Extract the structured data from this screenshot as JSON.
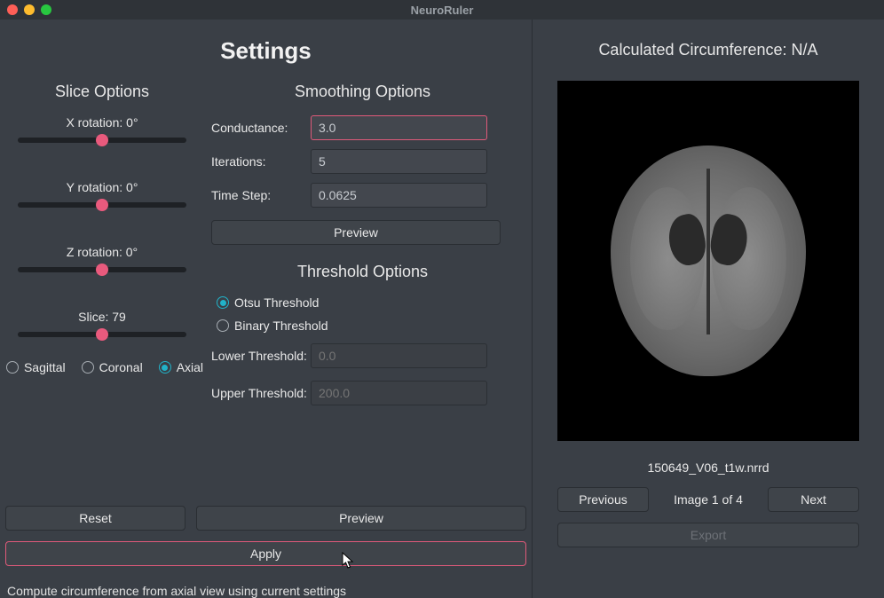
{
  "window": {
    "title": "NeuroRuler"
  },
  "settings_heading": "Settings",
  "slice": {
    "heading": "Slice Options",
    "x_label": "X rotation: 0°",
    "y_label": "Y rotation: 0°",
    "z_label": "Z rotation: 0°",
    "slice_label": "Slice: 79",
    "views": {
      "sagittal": "Sagittal",
      "coronal": "Coronal",
      "axial": "Axial"
    },
    "selected_view": "axial"
  },
  "smoothing": {
    "heading": "Smoothing Options",
    "conductance_label": "Conductance:",
    "conductance_value": "3.0",
    "iterations_label": "Iterations:",
    "iterations_value": "5",
    "timestep_label": "Time Step:",
    "timestep_value": "0.0625",
    "preview_label": "Preview"
  },
  "threshold": {
    "heading": "Threshold Options",
    "otsu_label": "Otsu Threshold",
    "binary_label": "Binary Threshold",
    "lower_label": "Lower Threshold:",
    "lower_placeholder": "0.0",
    "upper_label": "Upper Threshold:",
    "upper_placeholder": "200.0",
    "preview_label": "Preview",
    "selected": "otsu"
  },
  "actions": {
    "reset": "Reset",
    "apply": "Apply"
  },
  "status": "Compute circumference from axial view using current settings",
  "result": {
    "heading": "Calculated Circumference: N/A",
    "filename": "150649_V06_t1w.nrrd",
    "prev": "Previous",
    "next": "Next",
    "counter": "Image 1 of 4",
    "export": "Export"
  }
}
